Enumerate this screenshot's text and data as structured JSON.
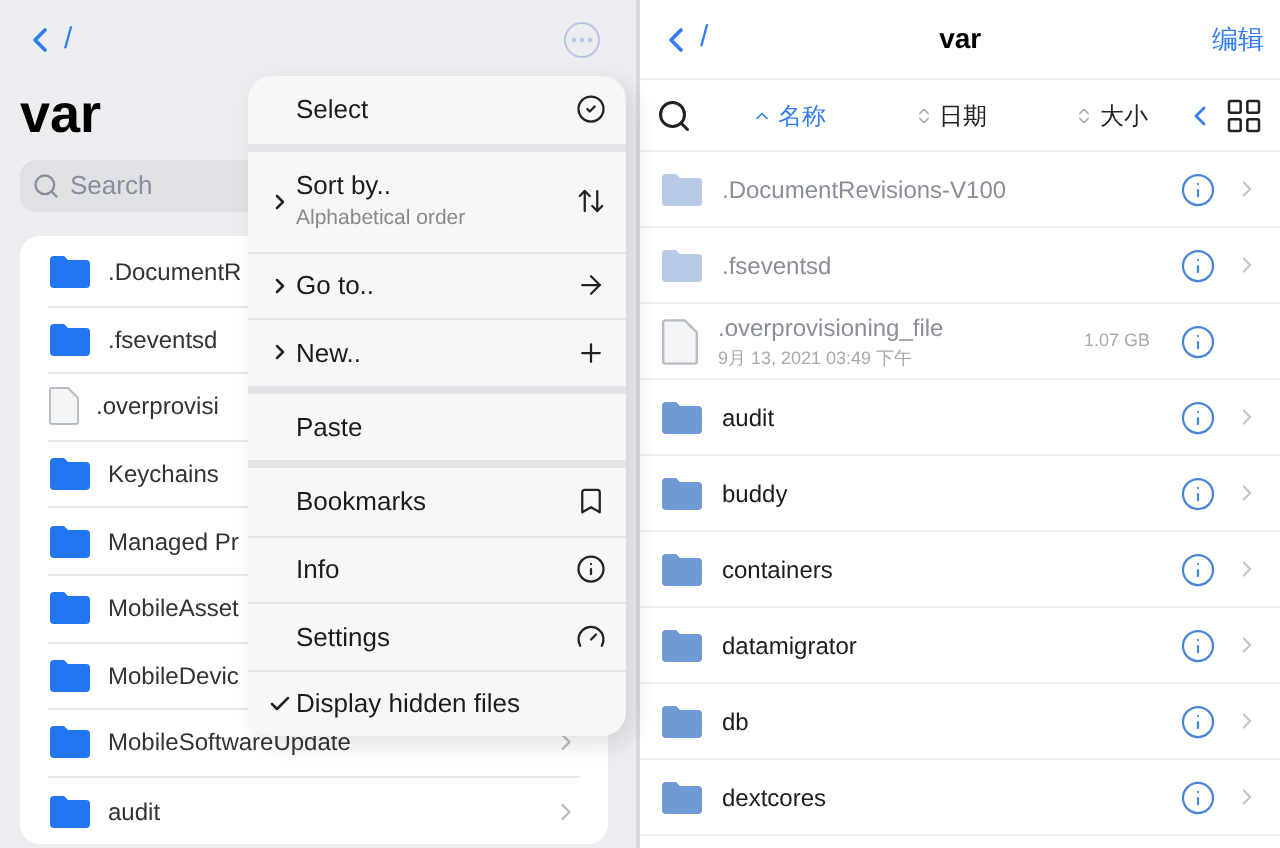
{
  "left_pane": {
    "back_path": "/",
    "title": "var",
    "search": {
      "placeholder": "Search"
    },
    "items": [
      {
        "kind": "folder",
        "name": ".DocumentR"
      },
      {
        "kind": "folder",
        "name": ".fseventsd"
      },
      {
        "kind": "file",
        "name": ".overprovisi"
      },
      {
        "kind": "folder",
        "name": "Keychains"
      },
      {
        "kind": "folder",
        "name": "Managed Pr"
      },
      {
        "kind": "folder",
        "name": "MobileAsset"
      },
      {
        "kind": "folder",
        "name": "MobileDevic"
      },
      {
        "kind": "folder",
        "name": "MobileSoftwareUpdate",
        "chevron": true
      },
      {
        "kind": "folder",
        "name": "audit",
        "chevron": true
      }
    ]
  },
  "menu": {
    "sections": [
      [
        {
          "kind": "plain",
          "label": "Select"
        }
      ],
      [
        {
          "kind": "submenu",
          "label": "Sort by..",
          "subtitle": "Alphabetical order"
        },
        {
          "kind": "submenu",
          "label": "Go to.."
        },
        {
          "kind": "submenu",
          "label": "New.."
        }
      ],
      [
        {
          "kind": "plain",
          "label": "Paste"
        }
      ],
      [
        {
          "kind": "plain",
          "label": "Bookmarks"
        },
        {
          "kind": "plain",
          "label": "Info"
        },
        {
          "kind": "plain",
          "label": "Settings"
        },
        {
          "kind": "toggle",
          "label": "Display hidden files",
          "checked": true
        }
      ]
    ]
  },
  "right_pane": {
    "back_path": "/",
    "title": "var",
    "edit_label": "编辑",
    "sort_options": [
      {
        "label": "名称",
        "selected": true
      },
      {
        "label": "日期",
        "selected": false
      },
      {
        "label": "大小",
        "selected": false
      }
    ],
    "items": [
      {
        "kind": "folder",
        "name": ".DocumentRevisions-V100",
        "hidden": true
      },
      {
        "kind": "folder",
        "name": ".fseventsd",
        "hidden": true
      },
      {
        "kind": "file",
        "name": ".overprovisioning_file",
        "date": "9月 13, 2021 03:49 下午",
        "size": "1.07 GB",
        "hidden": true
      },
      {
        "kind": "folder",
        "name": "audit",
        "hidden": false
      },
      {
        "kind": "folder",
        "name": "buddy",
        "hidden": false
      },
      {
        "kind": "folder",
        "name": "containers",
        "hidden": false
      },
      {
        "kind": "folder",
        "name": "datamigrator",
        "hidden": false
      },
      {
        "kind": "folder",
        "name": "db",
        "hidden": false
      },
      {
        "kind": "folder",
        "name": "dextcores",
        "hidden": false
      }
    ]
  }
}
